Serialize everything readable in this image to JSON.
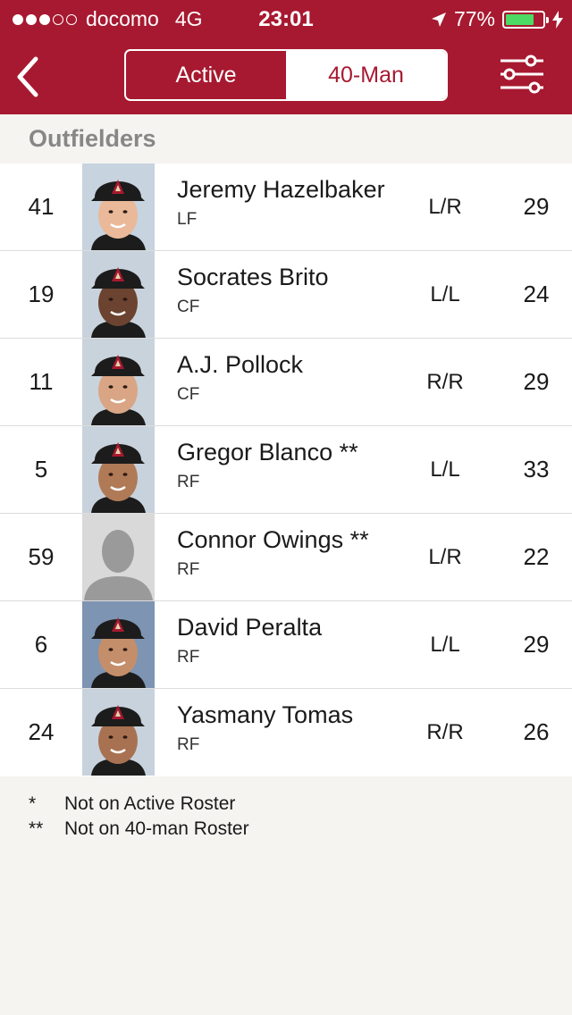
{
  "status_bar": {
    "carrier": "docomo",
    "network": "4G",
    "time": "23:01",
    "battery_pct": "77%",
    "battery_level": 0.77,
    "signal_bars_filled": 3,
    "signal_bars_total": 5
  },
  "nav": {
    "back_icon": "chevron-left-icon",
    "tabs": [
      {
        "label": "Active",
        "selected": false
      },
      {
        "label": "40-Man",
        "selected": true
      }
    ],
    "filter_icon": "sliders-icon"
  },
  "section": {
    "title": "Outfielders"
  },
  "players": [
    {
      "number": "41",
      "name": "Jeremy Hazelbaker",
      "position": "LF",
      "bats_throws": "L/R",
      "age": "29",
      "skin": "#e9b99a",
      "bg": "#c7d3de",
      "has_photo": true
    },
    {
      "number": "19",
      "name": "Socrates Brito",
      "position": "CF",
      "bats_throws": "L/L",
      "age": "24",
      "skin": "#6b4330",
      "bg": "#c8d2dc",
      "has_photo": true
    },
    {
      "number": "11",
      "name": "A.J. Pollock",
      "position": "CF",
      "bats_throws": "R/R",
      "age": "29",
      "skin": "#d9a585",
      "bg": "#c9d3dc",
      "has_photo": true
    },
    {
      "number": "5",
      "name": "Gregor Blanco **",
      "position": "RF",
      "bats_throws": "L/L",
      "age": "33",
      "skin": "#b07a57",
      "bg": "#c8d2dc",
      "has_photo": true
    },
    {
      "number": "59",
      "name": "Connor Owings **",
      "position": "RF",
      "bats_throws": "L/R",
      "age": "22",
      "skin": "#9a9a9a",
      "bg": "#d9d9d9",
      "has_photo": false
    },
    {
      "number": "6",
      "name": "David Peralta",
      "position": "RF",
      "bats_throws": "L/L",
      "age": "29",
      "skin": "#c48e6a",
      "bg": "#7e94b3",
      "has_photo": true
    },
    {
      "number": "24",
      "name": "Yasmany Tomas",
      "position": "RF",
      "bats_throws": "R/R",
      "age": "26",
      "skin": "#a87252",
      "bg": "#c8d2dc",
      "has_photo": true
    }
  ],
  "legend": [
    {
      "symbol": "*",
      "text": "Not on Active Roster"
    },
    {
      "symbol": "**",
      "text": "Not on 40-man Roster"
    }
  ],
  "colors": {
    "brand": "#a71930",
    "cap": "#1c1c1c",
    "battery": "#4cd964"
  }
}
